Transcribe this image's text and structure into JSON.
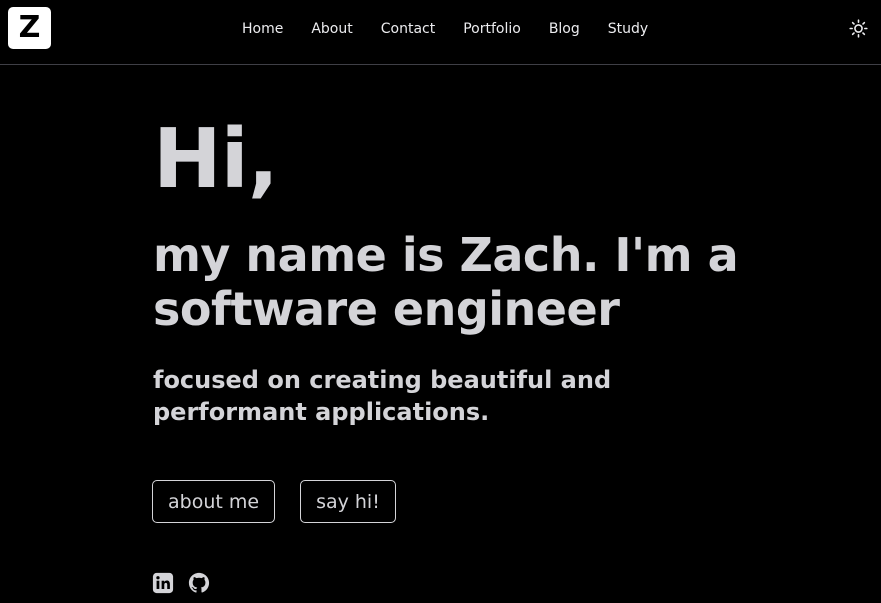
{
  "header": {
    "logo_text": "Z",
    "nav": [
      "Home",
      "About",
      "Contact",
      "Portfolio",
      "Blog",
      "Study"
    ],
    "theme_toggle_icon": "sun-icon"
  },
  "hero": {
    "greeting": "Hi,",
    "intro": "my name is Zach. I'm a software engineer",
    "subtitle": "focused on creating beautiful and performant applications."
  },
  "buttons": {
    "about": "about me",
    "contact": "say hi!"
  },
  "socials": {
    "icons": [
      "linkedin-icon",
      "github-icon"
    ]
  },
  "colors": {
    "background": "#000000",
    "text": "#d4d4d8",
    "divider": "#3f3f46"
  }
}
